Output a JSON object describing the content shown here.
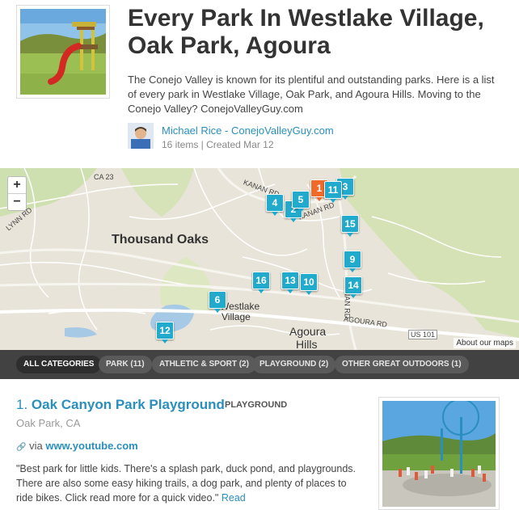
{
  "list": {
    "title": "Every Park In Westlake Village, Oak Park, Agoura",
    "description": "The Conejo Valley is known for its plentiful and outstanding parks. Here is a list of every park in Westlake Village, Oak Park, and Agoura Hills. Moving to the Conejo Valley? ConejoValleyGuy.com",
    "author": "Michael Rice - ConejoValleyGuy.com",
    "meta": "16 items | Created Mar 12"
  },
  "map": {
    "zoom_in": "+",
    "zoom_out": "−",
    "about_link": "About our maps",
    "labels": {
      "city1": "Thousand Oaks",
      "city2": "Westlake",
      "city2b": "Village",
      "city3": "Agoura",
      "city3b": "Hills",
      "road_ca23": "CA 23",
      "road_kanan1": "KANAN RD",
      "road_kanan2": "KANAN RD",
      "road_kanan3": "KANAN RD",
      "road_lynn": "LYNN RD",
      "road_agoura": "AGOURA RD",
      "road_us101": "US 101"
    },
    "markers": [
      {
        "label": "1",
        "active": true
      },
      {
        "label": "2",
        "active": false
      },
      {
        "label": "3",
        "active": false
      },
      {
        "label": "4",
        "active": false
      },
      {
        "label": "5",
        "active": false
      },
      {
        "label": "6",
        "active": false
      },
      {
        "label": "9",
        "active": false
      },
      {
        "label": "10",
        "active": false
      },
      {
        "label": "11",
        "active": false
      },
      {
        "label": "12",
        "active": false
      },
      {
        "label": "13",
        "active": false
      },
      {
        "label": "14",
        "active": false
      },
      {
        "label": "15",
        "active": false
      },
      {
        "label": "16",
        "active": false
      }
    ]
  },
  "categories": [
    {
      "label": "ALL CATEGORIES",
      "active": true
    },
    {
      "label": "PARK (11)",
      "active": false
    },
    {
      "label": "ATHLETIC & SPORT (2)",
      "active": false
    },
    {
      "label": "PLAYGROUND (2)",
      "active": false
    },
    {
      "label": "OTHER GREAT OUTDOORS (1)",
      "active": false
    }
  ],
  "item": {
    "number": "1.",
    "title": "Oak Canyon Park Playground",
    "category": "PLAYGROUND",
    "location": "Oak Park, CA",
    "via_prefix": "via",
    "via_link": "www.youtube.com",
    "quote": "\"Best park for little kids. There's a splash park, duck pond, and playgrounds. There are also some easy hiking trails, a dog park, and plenty of places to ride bikes. Click read more for a quick video.\"",
    "read_more": "Read"
  },
  "colors": {
    "accent": "#2a8fbd",
    "marker": "#22aacd",
    "marker_active": "#f06a2a",
    "category_bar": "#424242"
  }
}
